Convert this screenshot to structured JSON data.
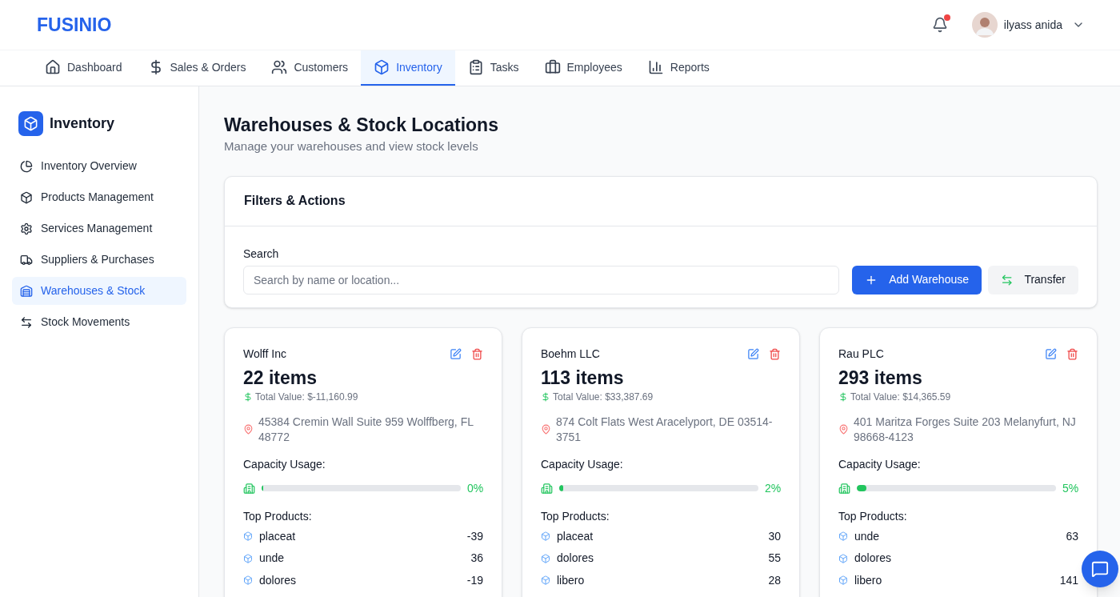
{
  "brand": "FUSINIO",
  "user": {
    "name": "ilyass anida",
    "has_notification": true
  },
  "nav": [
    {
      "label": "Dashboard",
      "selected": false
    },
    {
      "label": "Sales & Orders",
      "selected": false
    },
    {
      "label": "Customers",
      "selected": false
    },
    {
      "label": "Inventory",
      "selected": true
    },
    {
      "label": "Tasks",
      "selected": false
    },
    {
      "label": "Employees",
      "selected": false
    },
    {
      "label": "Reports",
      "selected": false
    }
  ],
  "sidebar": {
    "title": "Inventory",
    "items": [
      {
        "label": "Inventory Overview",
        "selected": false
      },
      {
        "label": "Products Management",
        "selected": false
      },
      {
        "label": "Services Management",
        "selected": false
      },
      {
        "label": "Suppliers & Purchases",
        "selected": false
      },
      {
        "label": "Warehouses & Stock",
        "selected": true
      },
      {
        "label": "Stock Movements",
        "selected": false
      }
    ]
  },
  "page": {
    "title": "Warehouses & Stock Locations",
    "subtitle": "Manage your warehouses and view stock levels"
  },
  "filters": {
    "title": "Filters & Actions",
    "search_label": "Search",
    "placeholder": "Search by name or location...",
    "add_button": "Add Warehouse",
    "transfer_button": "Transfer"
  },
  "warehouses": [
    {
      "name": "Wolff Inc",
      "items": "22 items",
      "total_value": "Total Value: $-11,160.99",
      "address": "45384 Cremin Wall Suite 959 Wolffberg, FL 48772",
      "capacity_label": "Capacity Usage:",
      "level": 0,
      "percent": "0%",
      "top_label": "Top Products:",
      "products": [
        {
          "name": "placeat",
          "qty": "-39"
        },
        {
          "name": "unde",
          "qty": "36"
        },
        {
          "name": "dolores",
          "qty": "-19"
        }
      ]
    },
    {
      "name": "Boehm LLC",
      "items": "113 items",
      "total_value": "Total Value: $33,387.69",
      "address": "874 Colt Flats West Aracelyport, DE 03514-3751",
      "capacity_label": "Capacity Usage:",
      "level": 0.02,
      "percent": "2%",
      "top_label": "Top Products:",
      "products": [
        {
          "name": "placeat",
          "qty": "30"
        },
        {
          "name": "dolores",
          "qty": "55"
        },
        {
          "name": "libero",
          "qty": "28"
        }
      ]
    },
    {
      "name": "Rau PLC",
      "items": "293 items",
      "total_value": "Total Value: $14,365.59",
      "address": "401 Maritza Forges Suite 203 Melanyfurt, NJ 98668-4123",
      "capacity_label": "Capacity Usage:",
      "level": 0.05,
      "percent": "5%",
      "top_label": "Top Products:",
      "products": [
        {
          "name": "unde",
          "qty": "63"
        },
        {
          "name": "dolores"
        },
        {
          "name": "libero",
          "qty": "141"
        }
      ]
    }
  ]
}
